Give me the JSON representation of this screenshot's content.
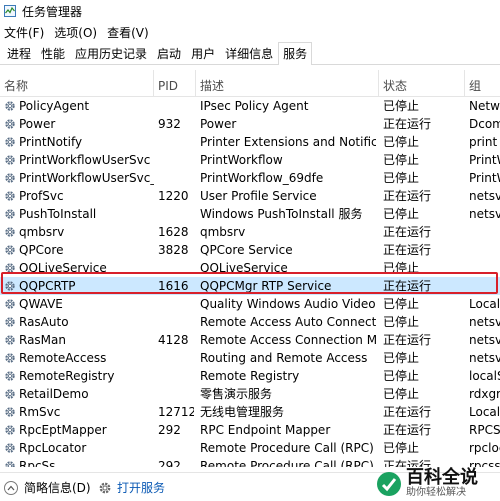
{
  "window": {
    "title": "任务管理器"
  },
  "menu": [
    "文件(F)",
    "选项(O)",
    "查看(V)"
  ],
  "tabs": [
    "进程",
    "性能",
    "应用历史记录",
    "启动",
    "用户",
    "详细信息",
    "服务"
  ],
  "selected_tab": "服务",
  "columns": {
    "name": "名称",
    "pid": "PID",
    "desc": "描述",
    "status": "状态",
    "group": "组"
  },
  "rows": [
    {
      "name": "PolicyAgent",
      "pid": "",
      "desc": "IPsec Policy Agent",
      "status": "已停止",
      "group": "Netwo"
    },
    {
      "name": "Power",
      "pid": "932",
      "desc": "Power",
      "status": "正在运行",
      "group": "Dcoml"
    },
    {
      "name": "PrintNotify",
      "pid": "",
      "desc": "Printer Extensions and Notificatio...",
      "status": "已停止",
      "group": "print"
    },
    {
      "name": "PrintWorkflowUserSvc",
      "pid": "",
      "desc": "PrintWorkflow",
      "status": "已停止",
      "group": "PrintW"
    },
    {
      "name": "PrintWorkflowUserSvc_6...",
      "pid": "",
      "desc": "PrintWorkflow_69dfe",
      "status": "已停止",
      "group": "PrintW"
    },
    {
      "name": "ProfSvc",
      "pid": "1220",
      "desc": "User Profile Service",
      "status": "正在运行",
      "group": "netsvc"
    },
    {
      "name": "PushToInstall",
      "pid": "",
      "desc": "Windows PushToInstall 服务",
      "status": "已停止",
      "group": "netsvc"
    },
    {
      "name": "qmbsrv",
      "pid": "1628",
      "desc": "qmbsrv",
      "status": "正在运行",
      "group": ""
    },
    {
      "name": "QPCore",
      "pid": "3828",
      "desc": "QPCore Service",
      "status": "正在运行",
      "group": ""
    },
    {
      "name": "QQLiveService",
      "pid": "",
      "desc": "QQLiveService",
      "status": "已停止",
      "group": ""
    },
    {
      "name": "QQPCRTP",
      "pid": "1616",
      "desc": "QQPCMgr RTP Service",
      "status": "正在运行",
      "group": ""
    },
    {
      "name": "QWAVE",
      "pid": "",
      "desc": "Quality Windows Audio Video Ex...",
      "status": "已停止",
      "group": "LocalS"
    },
    {
      "name": "RasAuto",
      "pid": "",
      "desc": "Remote Access Auto Connection ...",
      "status": "已停止",
      "group": "netsvc"
    },
    {
      "name": "RasMan",
      "pid": "4128",
      "desc": "Remote Access Connection Man...",
      "status": "正在运行",
      "group": "netsvc"
    },
    {
      "name": "RemoteAccess",
      "pid": "",
      "desc": "Routing and Remote Access",
      "status": "已停止",
      "group": "netsvc"
    },
    {
      "name": "RemoteRegistry",
      "pid": "",
      "desc": "Remote Registry",
      "status": "已停止",
      "group": "localS"
    },
    {
      "name": "RetailDemo",
      "pid": "",
      "desc": "零售演示服务",
      "status": "已停止",
      "group": "rdxgro"
    },
    {
      "name": "RmSvc",
      "pid": "12712",
      "desc": "无线电管理服务",
      "status": "正在运行",
      "group": "LocalS"
    },
    {
      "name": "RpcEptMapper",
      "pid": "292",
      "desc": "RPC Endpoint Mapper",
      "status": "正在运行",
      "group": "RPCSS"
    },
    {
      "name": "RpcLocator",
      "pid": "",
      "desc": "Remote Procedure Call (RPC) Loc...",
      "status": "已停止",
      "group": "rpcloc"
    },
    {
      "name": "RpcSs",
      "pid": "292",
      "desc": "Remote Procedure Call (RPC)",
      "status": "正在运行",
      "group": "rpcss"
    }
  ],
  "selected_row": "QQPCRTP",
  "footer": {
    "brief": "简略信息(D)",
    "open_services": "打开服务"
  },
  "watermark": {
    "line1": "百科全说",
    "line2": "助你轻松解决"
  }
}
